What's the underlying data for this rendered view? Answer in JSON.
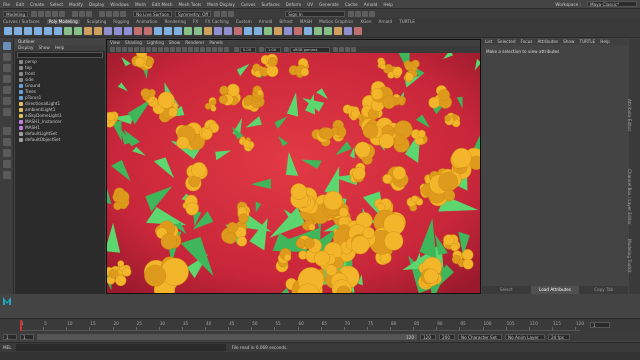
{
  "menubar": {
    "items": [
      "File",
      "Edit",
      "Create",
      "Select",
      "Modify",
      "Display",
      "Windows",
      "Mesh",
      "Edit Mesh",
      "Mesh Tools",
      "Mesh Display",
      "Curves",
      "Surfaces",
      "Deform",
      "UV",
      "Generate",
      "Cache",
      "Arnold",
      "Help"
    ],
    "workspace_label": "Workspace :",
    "workspace_value": "Maya Classic*"
  },
  "status": {
    "mode": "Modeling",
    "live_surface": "No Live Surface",
    "symmetry": "Symmetry: Off",
    "sign_in": "Sign In"
  },
  "shelf_tabs": [
    "Curves / Surfaces",
    "Poly Modeling",
    "Sculpting",
    "Rigging",
    "Animation",
    "Rendering",
    "FX",
    "FX Caching",
    "Custom",
    "Arnold",
    "Bifrost",
    "MASH",
    "Motion Graphics",
    "XGen",
    "Arnold",
    "TURTLE"
  ],
  "shelf_active": "Poly Modeling",
  "outliner": {
    "title": "Outliner",
    "menu": [
      "Display",
      "Show",
      "Help"
    ],
    "items": [
      {
        "label": "persp",
        "color": "#8a8a8a"
      },
      {
        "label": "top",
        "color": "#8a8a8a"
      },
      {
        "label": "front",
        "color": "#8a8a8a"
      },
      {
        "label": "side",
        "color": "#8a8a8a"
      },
      {
        "label": "Ground",
        "color": "#6aa0d8"
      },
      {
        "label": "Trees",
        "color": "#6aa0d8"
      },
      {
        "label": "pTorus1",
        "color": "#6aa0d8"
      },
      {
        "label": "directionalLight1",
        "color": "#e0c060"
      },
      {
        "label": "ambientLight1",
        "color": "#e0c060"
      },
      {
        "label": "aiSkyDomeLight1",
        "color": "#e0c060"
      },
      {
        "label": "MASH1_Instancer",
        "color": "#c080e0"
      },
      {
        "label": "MASH1",
        "color": "#c080e0"
      },
      {
        "label": "defaultLightSet",
        "color": "#a0a0a0"
      },
      {
        "label": "defaultObjectSet",
        "color": "#a0a0a0"
      }
    ]
  },
  "viewport": {
    "menu": [
      "View",
      "Shading",
      "Lighting",
      "Show",
      "Renderer",
      "Panels"
    ],
    "exposure": "0.00",
    "gamma": "1.00",
    "color_space": "sRGB gamma"
  },
  "attribute_editor": {
    "menu": [
      "List",
      "Selected",
      "Focus",
      "Attributes",
      "Show",
      "TURTLE",
      "Help"
    ],
    "message": "Make a selection to view attributes",
    "tabs": [
      "Select",
      "Load Attributes",
      "Copy Tab"
    ],
    "active_tab": "Load Attributes"
  },
  "side_tabs": [
    "Attribute Editor",
    "Channel Box / Layer Editor",
    "Modeling Toolkit"
  ],
  "timeline": {
    "labels": [
      "1",
      "5",
      "10",
      "15",
      "20",
      "25",
      "30",
      "35",
      "40",
      "45",
      "50",
      "55",
      "60",
      "65",
      "70",
      "75",
      "80",
      "85",
      "90",
      "95",
      "100",
      "105",
      "110",
      "115",
      "120"
    ],
    "current_frame": "1"
  },
  "range": {
    "start": "1",
    "range_start": "1",
    "range_end": "120",
    "end": "120",
    "end2": "200",
    "fps": "24 fps",
    "character_set": "No Character Set",
    "anim_layer": "No Anim Layer"
  },
  "commandline": {
    "lang": "MEL",
    "result": "File read in  0.069 seconds."
  },
  "colors": {
    "ground": "#d8323e",
    "flowers": "#f3b62a",
    "trees": "#5cd66e",
    "maya_logo": "#1fa7c0"
  }
}
